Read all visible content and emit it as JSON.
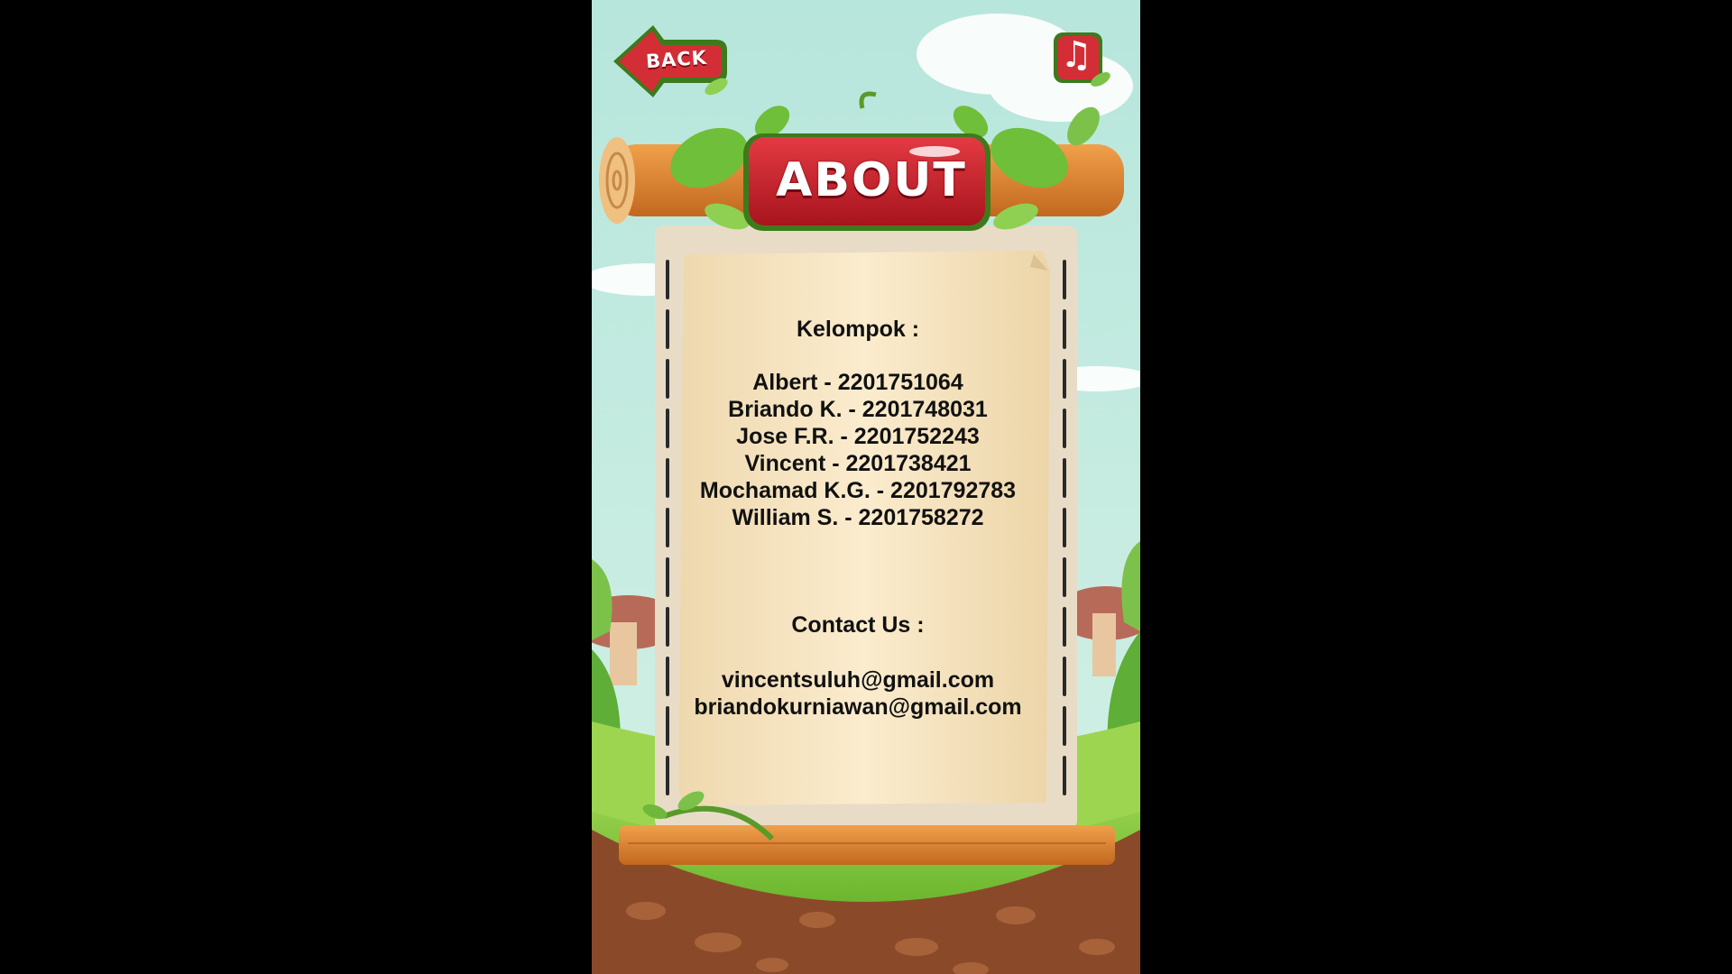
{
  "header": {
    "back_label": "BACK",
    "music_icon": "music-note-icon",
    "title": "ABOUT"
  },
  "group": {
    "heading": "Kelompok :",
    "members": [
      "Albert - 2201751064",
      "Briando K. - 2201748031",
      "Jose F.R. - 2201752243",
      "Vincent - 2201738421",
      "Mochamad K.G. - 2201792783",
      "William S. - 2201758272"
    ]
  },
  "contact": {
    "heading": "Contact Us :",
    "emails": [
      "vincentsuluh@gmail.com",
      "briandokurniawan@gmail.com"
    ]
  },
  "colors": {
    "button_red": "#c8262e",
    "leaf_green": "#6fbf3a",
    "wood": "#d9832f",
    "parchment": "#f3e2bf"
  }
}
